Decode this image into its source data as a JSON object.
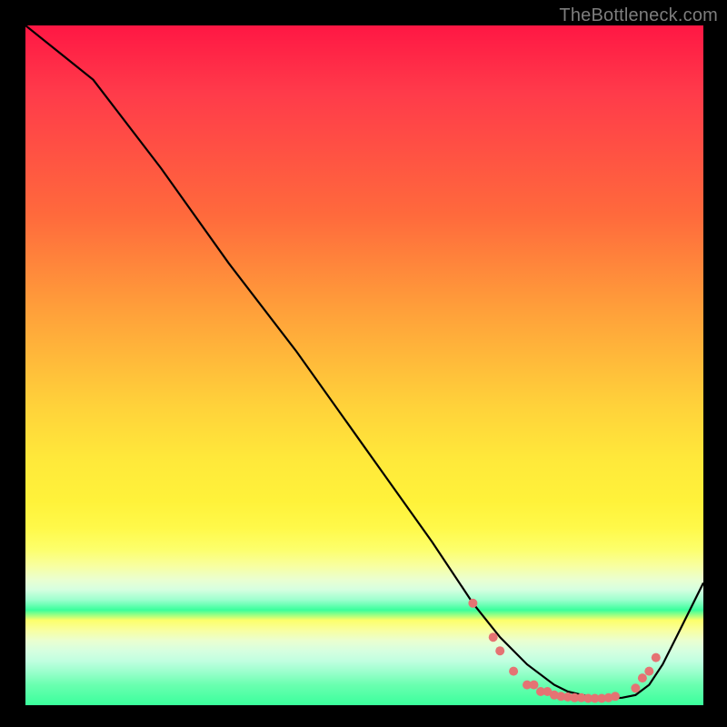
{
  "attribution": "TheBottleneck.com",
  "chart_data": {
    "type": "line",
    "title": "",
    "xlabel": "",
    "ylabel": "",
    "xlim": [
      0,
      100
    ],
    "ylim": [
      0,
      100
    ],
    "background_gradient": [
      {
        "pct": 0,
        "color": "#ff1744"
      },
      {
        "pct": 35,
        "color": "#ff8a3a"
      },
      {
        "pct": 60,
        "color": "#ffe93a"
      },
      {
        "pct": 80,
        "color": "#f8ffa0"
      },
      {
        "pct": 100,
        "color": "#3aff9c"
      }
    ],
    "series": [
      {
        "name": "bottleneck-curve",
        "color": "#000000",
        "x": [
          0,
          5,
          10,
          20,
          30,
          40,
          50,
          60,
          66,
          70,
          74,
          78,
          80,
          83,
          86,
          88,
          90,
          92,
          94,
          96,
          100
        ],
        "y": [
          100,
          96,
          92,
          79,
          65,
          52,
          38,
          24,
          15,
          10,
          6,
          3,
          2,
          1.3,
          1.0,
          1.1,
          1.5,
          3,
          6,
          10,
          18
        ]
      }
    ],
    "markers": {
      "name": "highlight-points",
      "color": "#e57373",
      "radius_px": 5,
      "points": [
        {
          "x": 66,
          "y": 15
        },
        {
          "x": 69,
          "y": 10
        },
        {
          "x": 70,
          "y": 8
        },
        {
          "x": 72,
          "y": 5
        },
        {
          "x": 74,
          "y": 3
        },
        {
          "x": 75,
          "y": 3
        },
        {
          "x": 76,
          "y": 2
        },
        {
          "x": 77,
          "y": 2
        },
        {
          "x": 78,
          "y": 1.5
        },
        {
          "x": 79,
          "y": 1.3
        },
        {
          "x": 80,
          "y": 1.2
        },
        {
          "x": 81,
          "y": 1.1
        },
        {
          "x": 82,
          "y": 1.1
        },
        {
          "x": 83,
          "y": 1.0
        },
        {
          "x": 84,
          "y": 1.0
        },
        {
          "x": 85,
          "y": 1.0
        },
        {
          "x": 86,
          "y": 1.1
        },
        {
          "x": 87,
          "y": 1.3
        },
        {
          "x": 90,
          "y": 2.5
        },
        {
          "x": 91,
          "y": 4
        },
        {
          "x": 92,
          "y": 5
        },
        {
          "x": 93,
          "y": 7
        }
      ]
    }
  }
}
